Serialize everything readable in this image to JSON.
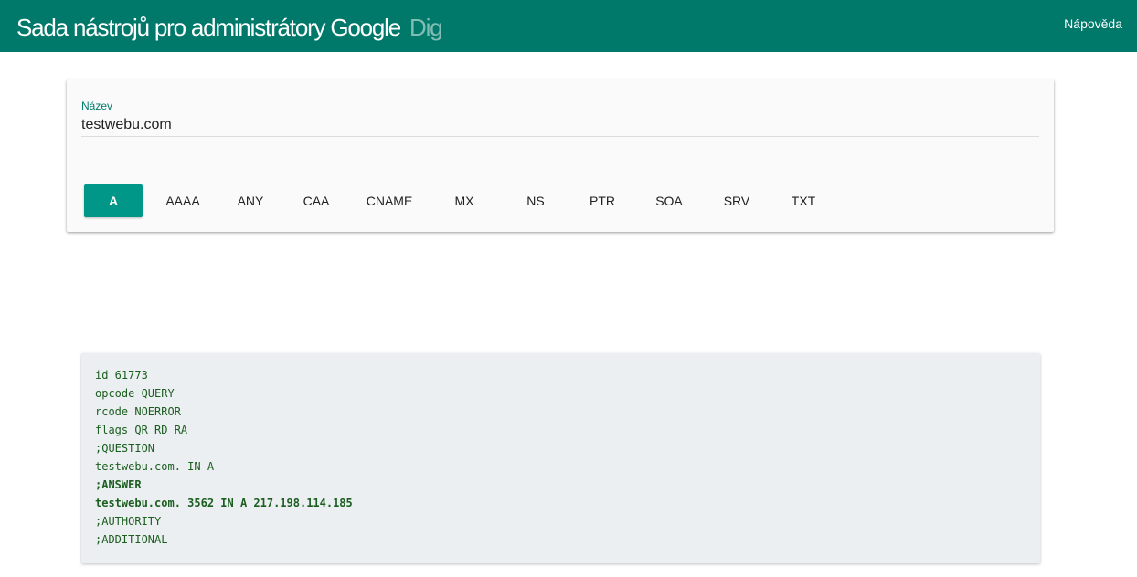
{
  "header": {
    "title": "Sada nástrojů pro administrátory Google",
    "subapp": "Dig",
    "help_label": "Nápověda"
  },
  "query": {
    "label": "Název",
    "value": "testwebu.com"
  },
  "record_types": {
    "selected": "A",
    "items": [
      "A",
      "AAAA",
      "ANY",
      "CAA",
      "CNAME",
      "MX",
      "NS",
      "PTR",
      "SOA",
      "SRV",
      "TXT"
    ]
  },
  "result": {
    "lines": [
      {
        "text": "id 61773",
        "bold": false
      },
      {
        "text": "opcode QUERY",
        "bold": false
      },
      {
        "text": "rcode NOERROR",
        "bold": false
      },
      {
        "text": "flags QR RD RA",
        "bold": false
      },
      {
        "text": ";QUESTION",
        "bold": false
      },
      {
        "text": "testwebu.com. IN A",
        "bold": false
      },
      {
        "text": ";ANSWER",
        "bold": true
      },
      {
        "text": "testwebu.com. 3562 IN A 217.198.114.185",
        "bold": true
      },
      {
        "text": ";AUTHORITY",
        "bold": false
      },
      {
        "text": ";ADDITIONAL",
        "bold": false
      }
    ]
  },
  "colors": {
    "header_bg": "#00796b",
    "accent": "#009688",
    "result_text": "#1b5e20",
    "result_bg": "#eceff1"
  }
}
